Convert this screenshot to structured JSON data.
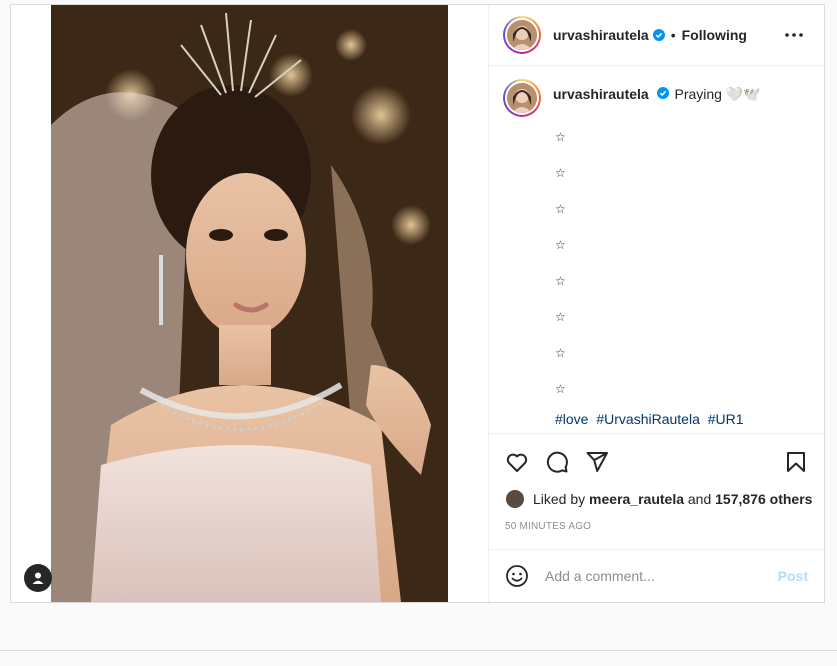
{
  "post": {
    "author": "urvashirautela",
    "follow_status": "Following",
    "separator": "•",
    "caption": {
      "text": "Praying 🤍🕊️",
      "stars": [
        "☆",
        "☆",
        "☆",
        "☆",
        "☆",
        "☆",
        "☆",
        "☆"
      ],
      "hashtags": [
        "#love",
        "#UrvashiRautela",
        "#UR1"
      ]
    },
    "likes": {
      "prefix": "Liked by",
      "liker": "meera_rautela",
      "joiner": "and",
      "count": "157,876 others"
    },
    "timestamp": "50 MINUTES AGO",
    "comment": {
      "placeholder": "Add a comment...",
      "post_label": "Post"
    }
  },
  "colors": {
    "link": "#00376b",
    "verified": "#0095f6",
    "post_disabled": "#b3dbff",
    "muted": "#8e8e8e"
  },
  "icons": [
    "user-tag-icon",
    "verified-badge-icon",
    "more-options-icon",
    "heart-icon",
    "comment-icon",
    "share-icon",
    "bookmark-icon",
    "emoji-icon"
  ]
}
